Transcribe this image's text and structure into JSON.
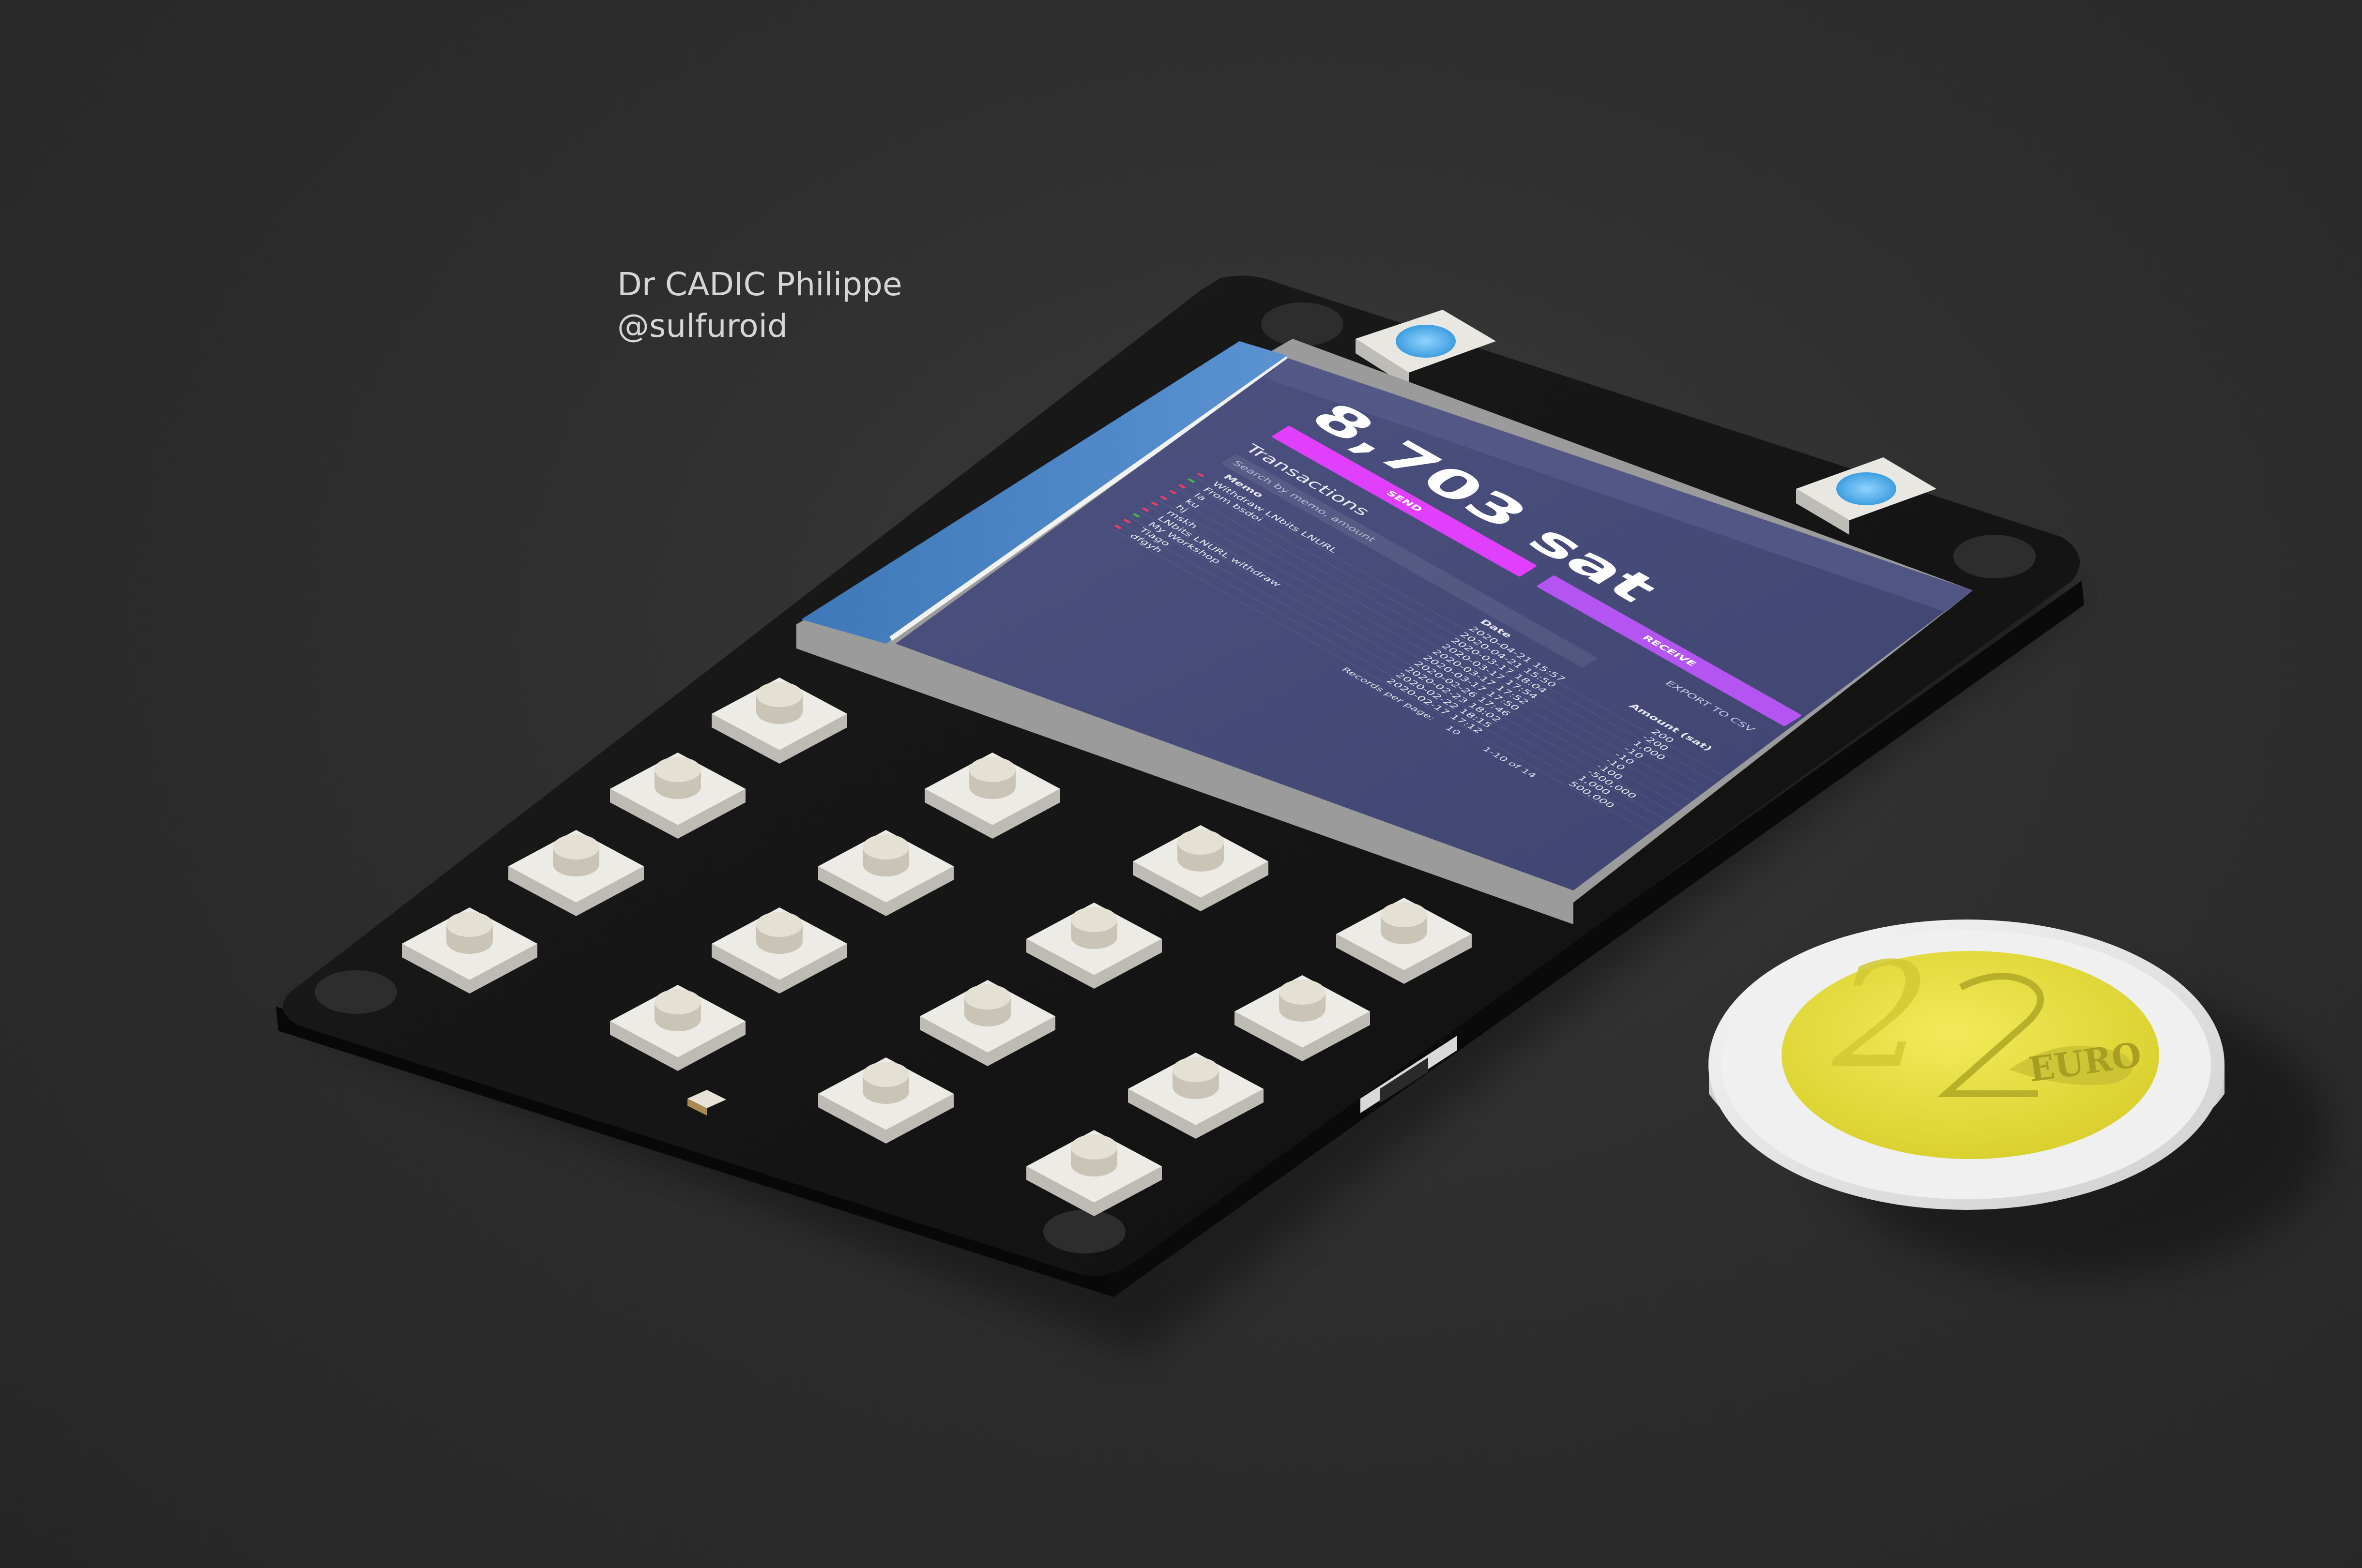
{
  "credit": {
    "name": "Dr CADIC Philippe",
    "handle": "@sulfuroid"
  },
  "screen": {
    "balance": "8,703 sat",
    "send_label": "SEND",
    "receive_label": "RECEIVE",
    "transactions_title": "Transactions",
    "search_placeholder": "Search by memo, amount",
    "export_label": "EXPORT TO CSV",
    "columns": {
      "memo": "Memo",
      "date": "Date",
      "amount": "Amount (sat)"
    },
    "rows": [
      {
        "memo": "Withdraw LNbits LNURL",
        "date": "2020-04-21 15:57",
        "amount": "200",
        "status": "out"
      },
      {
        "memo": "From bsdoi",
        "date": "2020-04-21 15:50",
        "amount": "-200",
        "status": "in"
      },
      {
        "memo": "la",
        "date": "2020-03-17 18:04",
        "amount": "1,000",
        "status": "out"
      },
      {
        "memo": "ku",
        "date": "2020-03-17 17:54",
        "amount": "-10",
        "status": "out"
      },
      {
        "memo": "hj",
        "date": "2020-03-17 17:52",
        "amount": "-10",
        "status": "out"
      },
      {
        "memo": "mskh",
        "date": "2020-03-17 17:50",
        "amount": "-10",
        "status": "out"
      },
      {
        "memo": "LNbits LNURL withdraw",
        "date": "2020-02-26 17:46",
        "amount": "-100",
        "status": "out"
      },
      {
        "memo": "My Workshop",
        "date": "2020-02-23 18:02",
        "amount": "-500,000",
        "status": "in"
      },
      {
        "memo": "Tiago",
        "date": "2020-02-22 18:15",
        "amount": "1,000",
        "status": "out"
      },
      {
        "memo": "dfgyh",
        "date": "2020-02-17 17:12",
        "amount": "500,000",
        "status": "out"
      }
    ],
    "records_per_page_label": "Records per page:",
    "records_per_page_value": "10",
    "pagination_text": "1-10 of 14",
    "colors": {
      "send": "#e040fb",
      "receive": "#b455f2",
      "screen_bg": "#4a4e7c",
      "status_in": "#4caf50",
      "status_out": "#e53e6a"
    }
  },
  "coin": {
    "denomination": "2",
    "currency": "EURO"
  },
  "colors": {
    "background": "#2e2e2e",
    "pcb": "#141414",
    "display_flex": "#4a84c4",
    "button_body": "#ecebe6",
    "coin_core": "#e7de42",
    "coin_ring": "#e6e6e6",
    "led": "#5db6f0"
  }
}
